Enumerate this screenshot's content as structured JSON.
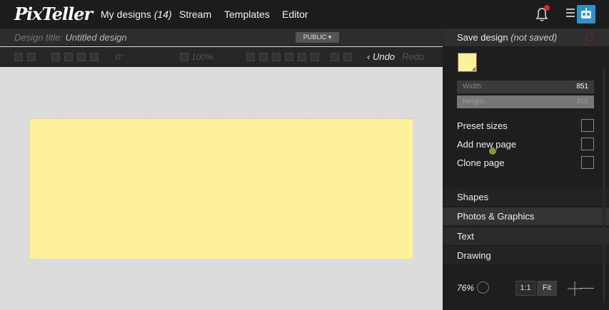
{
  "nav": {
    "logo": "PixTeller",
    "my_designs": "My designs",
    "my_designs_count": "(14)",
    "stream": "Stream",
    "templates": "Templates",
    "editor": "Editor"
  },
  "design": {
    "title_label": "Design title:",
    "title_value": "Untitled design",
    "visibility": "PUBLIC ▾"
  },
  "toolbar": {
    "rotation": "0°",
    "opacity": "100%",
    "undo": "Undo",
    "redo": "Redo"
  },
  "panel": {
    "save_label": "Save design",
    "save_state": "(not saved)",
    "background_color": "#fff09a",
    "width_label": "Width:",
    "width_value": "851",
    "height_label": "Height:",
    "height_value": "315",
    "preset_sizes": "Preset sizes",
    "add_new_page": "Add new page",
    "clone_page": "Clone page",
    "sections": [
      "Shapes",
      "Photos & Graphics",
      "Text",
      "Drawing"
    ],
    "zoom": "76%",
    "one_to_one": "1:1",
    "fit": "Fit"
  },
  "colors": {
    "canvas_fill": "#fff09a",
    "notification_dot": "#e8202a",
    "avatar": "#2a93c9"
  }
}
